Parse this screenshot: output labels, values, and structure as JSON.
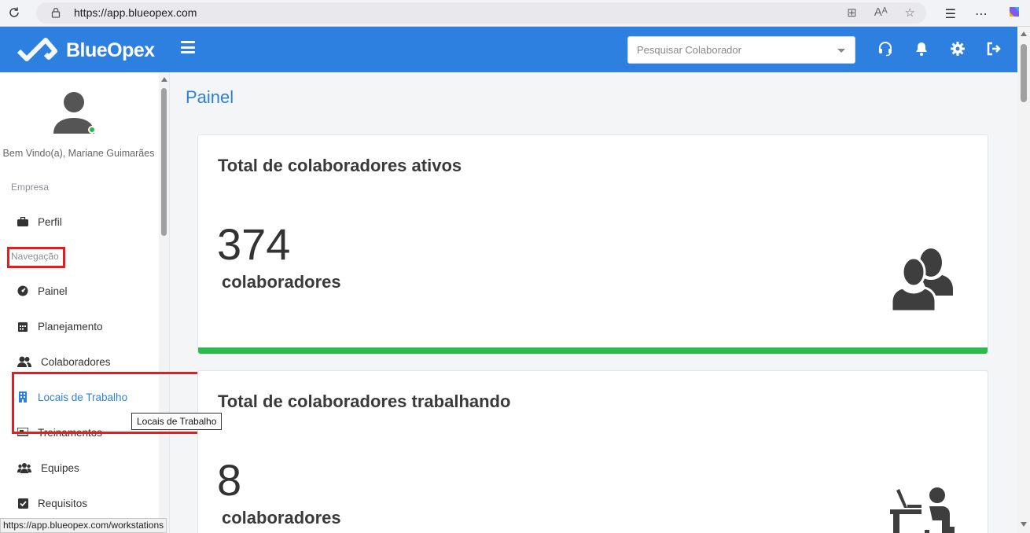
{
  "browser": {
    "url": "https://app.blueopex.com",
    "status_url": "https://app.blueopex.com/workstations"
  },
  "navbar": {
    "brand": "BlueOpex",
    "search_placeholder": "Pesquisar Colaborador",
    "accent_color": "#2d7fe0"
  },
  "sidebar": {
    "welcome": "Bem Vindo(a), Mariane Guimarães",
    "section_company": "Empresa",
    "section_navigation": "Navegação",
    "items": [
      {
        "label": "Perfil",
        "icon": "briefcase-icon"
      },
      {
        "label": "Painel",
        "icon": "dashboard-icon"
      },
      {
        "label": "Planejamento",
        "icon": "calendar-icon"
      },
      {
        "label": "Colaboradores",
        "icon": "users-icon"
      },
      {
        "label": "Locais de Trabalho",
        "icon": "building-icon"
      },
      {
        "label": "Treinamentos",
        "icon": "training-icon"
      },
      {
        "label": "Equipes",
        "icon": "team-icon"
      },
      {
        "label": "Requisitos",
        "icon": "checkbox-icon"
      }
    ],
    "tooltip": "Locais de Trabalho"
  },
  "main": {
    "title": "Painel",
    "cards": [
      {
        "title": "Total de colaboradores ativos",
        "value": "374",
        "unit": "colaboradores",
        "bar_color": "#2fb94c"
      },
      {
        "title": "Total de colaboradores trabalhando",
        "value": "8",
        "unit": "colaboradores"
      }
    ]
  }
}
